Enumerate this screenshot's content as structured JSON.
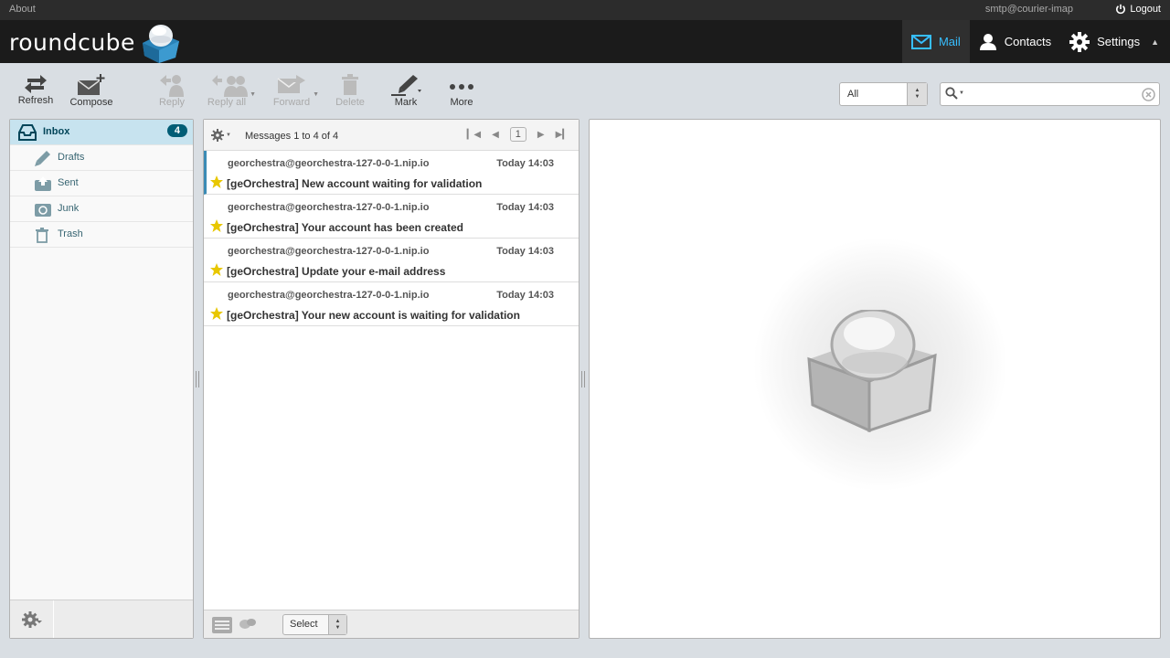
{
  "topline": {
    "about": "About",
    "user": "smtp@courier-imap",
    "logout": "Logout"
  },
  "header": {
    "logo_text": "roundcube",
    "nav": [
      {
        "label": "Mail",
        "icon": "mail-icon",
        "active": true
      },
      {
        "label": "Contacts",
        "icon": "contacts-icon",
        "active": false
      },
      {
        "label": "Settings",
        "icon": "settings-icon",
        "active": false
      }
    ]
  },
  "toolbar": {
    "refresh": "Refresh",
    "compose": "Compose",
    "reply": "Reply",
    "reply_all": "Reply all",
    "forward": "Forward",
    "delete": "Delete",
    "mark": "Mark",
    "more": "More"
  },
  "filter": {
    "value": "All"
  },
  "search": {
    "placeholder": ""
  },
  "folders": [
    {
      "name": "Inbox",
      "icon": "inbox-icon",
      "unread": "4",
      "active": true
    },
    {
      "name": "Drafts",
      "icon": "drafts-icon"
    },
    {
      "name": "Sent",
      "icon": "sent-icon"
    },
    {
      "name": "Junk",
      "icon": "junk-icon"
    },
    {
      "name": "Trash",
      "icon": "trash-icon"
    }
  ],
  "messagelist": {
    "count_text": "Messages 1 to 4 of 4",
    "page": "1",
    "select_label": "Select",
    "messages": [
      {
        "from": "georchestra@georchestra-127-0-0-1.nip.io",
        "date": "Today 14:03",
        "subject": "[geOrchestra] New account waiting for validation",
        "flagged": true
      },
      {
        "from": "georchestra@georchestra-127-0-0-1.nip.io",
        "date": "Today 14:03",
        "subject": "[geOrchestra] Your account has been created",
        "flagged": true
      },
      {
        "from": "georchestra@georchestra-127-0-0-1.nip.io",
        "date": "Today 14:03",
        "subject": "[geOrchestra] Update your e-mail address",
        "flagged": true
      },
      {
        "from": "georchestra@georchestra-127-0-0-1.nip.io",
        "date": "Today 14:03",
        "subject": "[geOrchestra] Your new account is waiting for validation",
        "flagged": true
      }
    ]
  },
  "colors": {
    "accent": "#37beff",
    "badge": "#005d76",
    "flag": "#e8c700",
    "header_bg": "#1b1b1b"
  }
}
